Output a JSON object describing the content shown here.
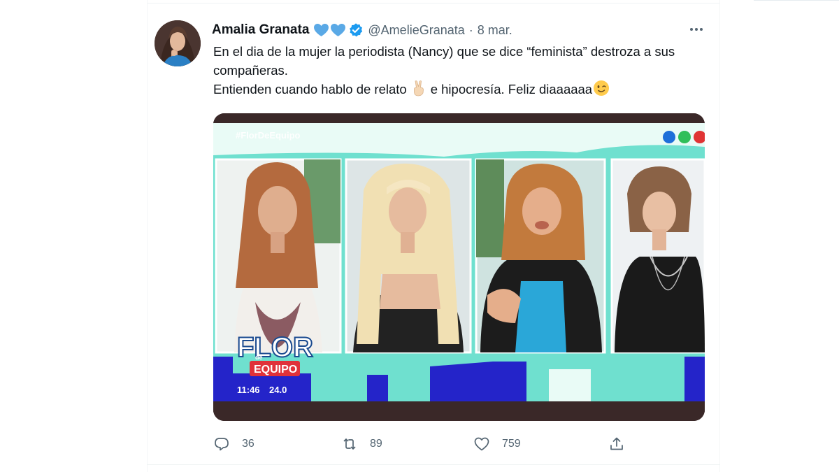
{
  "tweet": {
    "author_name": "Amalia Granata",
    "handle": "@AmelieGranata",
    "separator": "·",
    "date": "8 mar.",
    "text_line_1": "En el dia de la mujer la periodista (Nancy) que se dice “feminista” destroza a sus compañeras.",
    "text_line_2a": "Entienden cuando hablo de relato",
    "text_line_2b": "e hipocresía. Feliz diaaaaaa",
    "icons": {
      "hearts": "blue-heart-icon",
      "verified": "verified-badge-icon",
      "peace": "victory-hand-icon",
      "wink": "winking-face-icon",
      "more": "more-options-icon"
    },
    "colors": {
      "heart": "#5aa9e6",
      "verified": "#1d9bf0",
      "muted": "#536471",
      "text": "#0f1419"
    }
  },
  "media": {
    "hashtag": "#FlorDeEquipo",
    "logo_top": "FLOR",
    "logo_bottom": "EQUIPO",
    "logo_small": "de",
    "clock": "11:46",
    "temp": "24.0"
  },
  "actions": {
    "reply_count": "36",
    "retweet_count": "89",
    "like_count": "759",
    "icons": [
      "reply-icon",
      "retweet-icon",
      "like-icon",
      "share-icon"
    ]
  }
}
